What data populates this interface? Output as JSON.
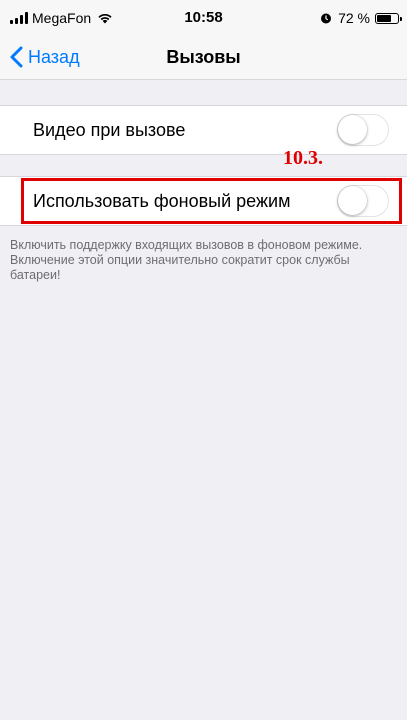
{
  "status_bar": {
    "carrier": "MegaFon",
    "time": "10:58",
    "battery_percent": "72 %",
    "battery_level": 0.72,
    "icons": [
      "signal-icon",
      "wifi-icon",
      "alarm-icon",
      "battery-icon"
    ]
  },
  "nav": {
    "back_label": "Назад",
    "title": "Вызовы"
  },
  "settings": [
    {
      "label": "Видео при вызове",
      "enabled": false
    },
    {
      "label": "Использовать фоновый режим",
      "enabled": false
    }
  ],
  "annotation": {
    "label": "10.3.",
    "color": "#e00000"
  },
  "footer": {
    "text": "Включить поддержку входящих вызовов в фоновом режиме. Включение этой опции значительно сократит срок службы батареи!"
  },
  "colors": {
    "accent": "#007aff",
    "background": "#efeff4",
    "highlight": "#e00000"
  }
}
